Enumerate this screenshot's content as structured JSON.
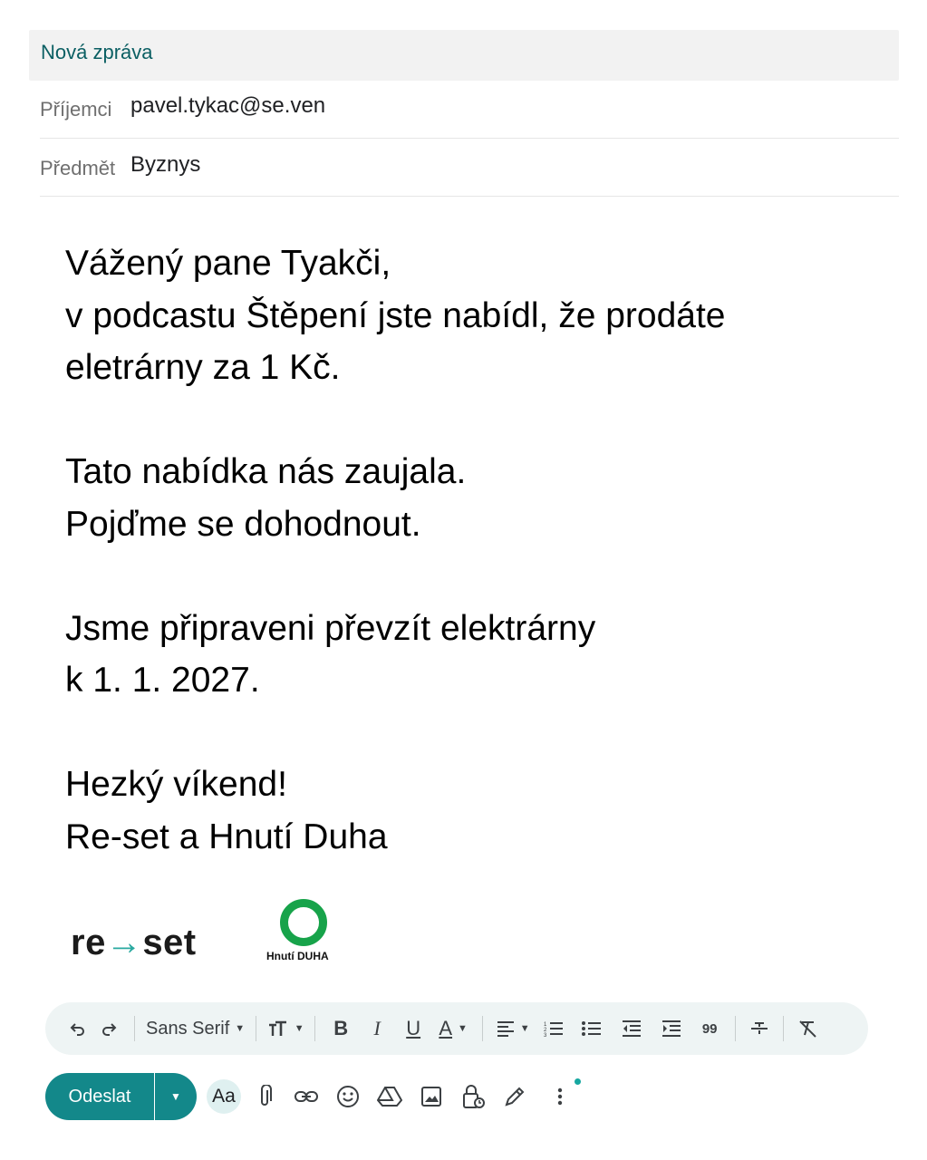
{
  "header": {
    "title": "Nová zpráva"
  },
  "to": {
    "label": "Příjemci",
    "value": "pavel.tykac@se.ven"
  },
  "subject": {
    "label": "Předmět",
    "value": "Byznys"
  },
  "body": {
    "lines": [
      "Vážený pane Tyakči,",
      "v podcastu Štěpení jste nabídl, že prodáte",
      "eletrárny za 1 Kč.",
      "",
      "Tato nabídka nás zaujala.",
      "Pojďme se dohodnout.",
      "",
      "Jsme připraveni převzít elektrárny",
      "k 1. 1. 2027.",
      "",
      "Hezký víkend!",
      "Re-set a Hnutí Duha"
    ]
  },
  "logos": {
    "reset_pre": "re",
    "reset_arrow": "→",
    "reset_post": "set",
    "duha_label": "Hnutí DUHA"
  },
  "toolbar": {
    "font_name": "Sans Serif",
    "icons": [
      "undo-icon",
      "redo-icon",
      "text-size-icon",
      "bold-icon",
      "italic-icon",
      "underline-icon",
      "text-color-icon",
      "align-icon",
      "numbered-list-icon",
      "bulleted-list-icon",
      "indent-less-icon",
      "indent-more-icon",
      "quote-icon",
      "strikethrough-icon",
      "remove-formatting-icon"
    ],
    "quote_glyph": "99"
  },
  "bottom": {
    "send_label": "Odeslat",
    "format_label": "Aa",
    "icons": [
      "attach-icon",
      "link-icon",
      "emoji-icon",
      "drive-icon",
      "image-icon",
      "confidential-icon",
      "signature-icon",
      "more-options-icon"
    ]
  },
  "colors": {
    "accent": "#13888a",
    "title": "#0b5f63",
    "duha_green": "#17a34a",
    "reset_arrow": "#2aa9a0"
  }
}
